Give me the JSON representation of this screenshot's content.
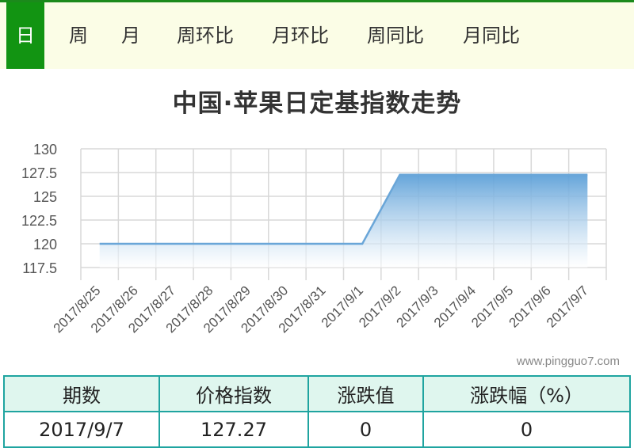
{
  "tabs": [
    "日",
    "周",
    "月",
    "周环比",
    "月环比",
    "周同比",
    "月同比"
  ],
  "active_tab": 0,
  "chart_data": {
    "type": "area",
    "title": "中国·苹果日定基指数走势",
    "categories": [
      "2017/8/25",
      "2017/8/26",
      "2017/8/27",
      "2017/8/28",
      "2017/8/29",
      "2017/8/30",
      "2017/8/31",
      "2017/9/1",
      "2017/9/2",
      "2017/9/3",
      "2017/9/4",
      "2017/9/5",
      "2017/9/6",
      "2017/9/7"
    ],
    "values": [
      120,
      120,
      120,
      120,
      120,
      120,
      120,
      120,
      127.27,
      127.27,
      127.27,
      127.27,
      127.27,
      127.27
    ],
    "yticks": [
      130,
      127.5,
      125,
      122.5,
      120,
      117.5
    ],
    "ylim": [
      117.5,
      130
    ],
    "grid": true,
    "line_color": "#6aa6d8",
    "fill_top_color": "#5da0d8",
    "fill_bottom_color": "#ffffff"
  },
  "watermark": "www.pingguo7.com",
  "table": {
    "headers": [
      "期数",
      "价格指数",
      "涨跌值",
      "涨跌幅（%）"
    ],
    "row": [
      "2017/9/7",
      "127.27",
      "0",
      "0"
    ]
  }
}
